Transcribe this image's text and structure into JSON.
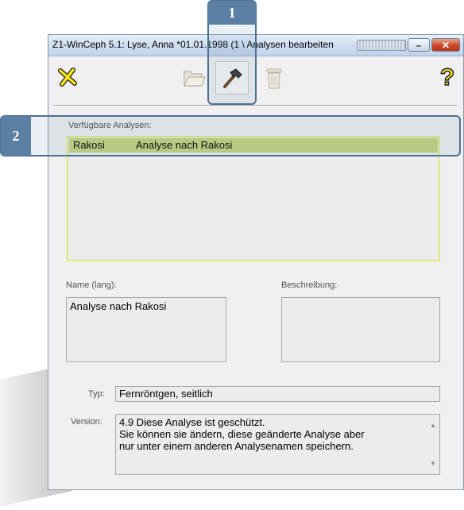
{
  "window": {
    "title": "Z1-WinCeph 5.1: Lyse, Anna *01.01.1998 (1 \\ Analysen bearbeiten",
    "minimize_label": "–",
    "close_label": "✕"
  },
  "toolbar": {
    "exit_icon": "exit-x-icon",
    "folder_icon": "folder-open-icon",
    "edit_icon": "hammer-icon",
    "delete_icon": "trash-icon",
    "help_icon": "help-question-icon",
    "help_label": "?"
  },
  "analyses": {
    "label": "Verfügbare Analysen:",
    "rows": [
      {
        "name": "Rakosi",
        "description": "Analyse nach Rakosi"
      }
    ]
  },
  "details": {
    "name_label": "Name (lang):",
    "name_value": "Analyse nach Rakosi",
    "description_label": "Beschreibung:",
    "description_value": "",
    "type_label": "Typ:",
    "type_value": "Fernröntgen, seitlich",
    "version_label": "Version:",
    "version_lines": [
      "4.9 Diese Analyse ist geschützt.",
      "Sie können sie ändern, diese geänderte Analyse aber",
      "nur unter einem anderen Analysenamen speichern."
    ]
  },
  "callouts": [
    "1",
    "2"
  ],
  "colors": {
    "selected_row": "#c5d47e",
    "list_border": "#e6e680",
    "callout": "#5c7fa4"
  }
}
